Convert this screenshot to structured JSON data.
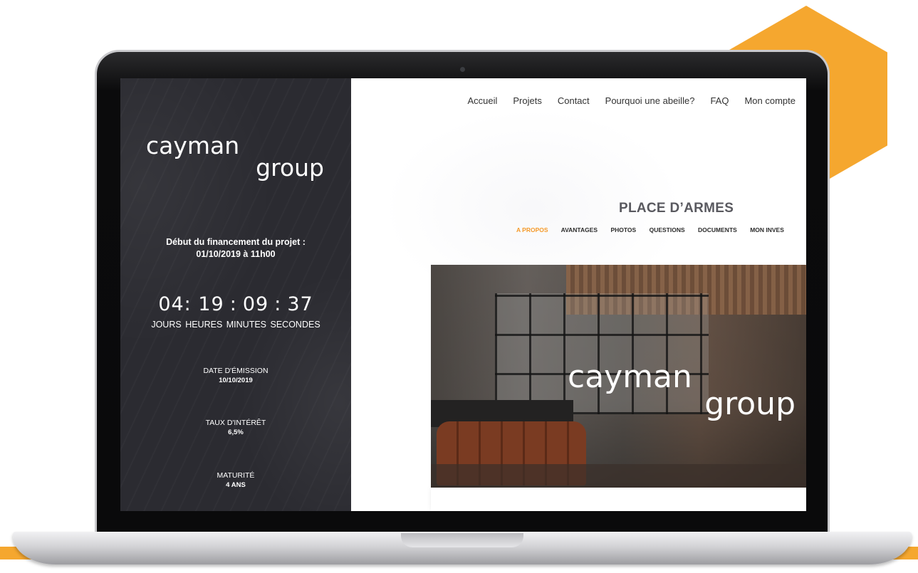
{
  "brand": {
    "line1": "cayman",
    "line2": "group"
  },
  "nav": {
    "items": [
      "Accueil",
      "Projets",
      "Contact",
      "Pourquoi une abeille?",
      "FAQ",
      "Mon compte"
    ]
  },
  "launch": {
    "label": "Début du financement du projet :",
    "datetime": "01/10/2019 à 11h00"
  },
  "countdown": {
    "days": "04:",
    "hours": "19",
    "minutes": "09",
    "seconds": "37",
    "separator": ":",
    "labels": [
      "JOURS",
      "HEURES",
      "MINUTES",
      "SECONDES"
    ]
  },
  "details": {
    "issue_date": {
      "label": "DATE D'ÉMISSION",
      "value": "10/10/2019"
    },
    "interest_rate": {
      "label": "TAUX D'INTÉRÊT",
      "value": "6,5%"
    },
    "maturity": {
      "label": "MATURITÉ",
      "value": "4 ANS"
    }
  },
  "project": {
    "title": "PLACE D’ARMES",
    "tabs": [
      "A PROPOS",
      "AVANTAGES",
      "PHOTOS",
      "QUESTIONS",
      "DOCUMENTS",
      "MON INVES"
    ],
    "active_tab": "A PROPOS"
  },
  "colors": {
    "accent": "#f5a72f",
    "panel": "#2b2b31",
    "active_tab": "#f59a2a"
  }
}
